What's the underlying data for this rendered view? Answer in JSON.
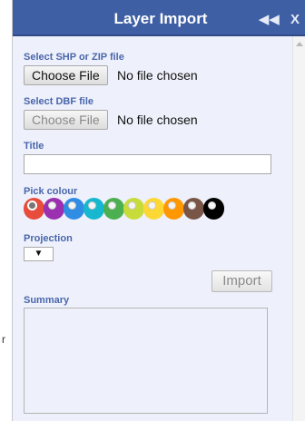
{
  "window": {
    "title": "Layer Import",
    "collapse_glyph": "◀◀",
    "close_glyph": "X"
  },
  "shp": {
    "label": "Select SHP or ZIP file",
    "button": "Choose File",
    "status": "No file chosen"
  },
  "dbf": {
    "label": "Select DBF file",
    "button": "Choose File",
    "status": "No file chosen"
  },
  "title_field": {
    "label": "Title",
    "value": ""
  },
  "colour": {
    "label": "Pick colour",
    "options": [
      "#e74c3c",
      "#9b30b0",
      "#2f8de4",
      "#17b7cf",
      "#4caf50",
      "#c7dc3a",
      "#fdd835",
      "#ff9800",
      "#795548",
      "#000000"
    ],
    "selected_index": 0
  },
  "projection": {
    "label": "Projection",
    "value": "▼"
  },
  "import_button": "Import",
  "summary": {
    "label": "Summary",
    "value": ""
  },
  "edge_mark": "r"
}
